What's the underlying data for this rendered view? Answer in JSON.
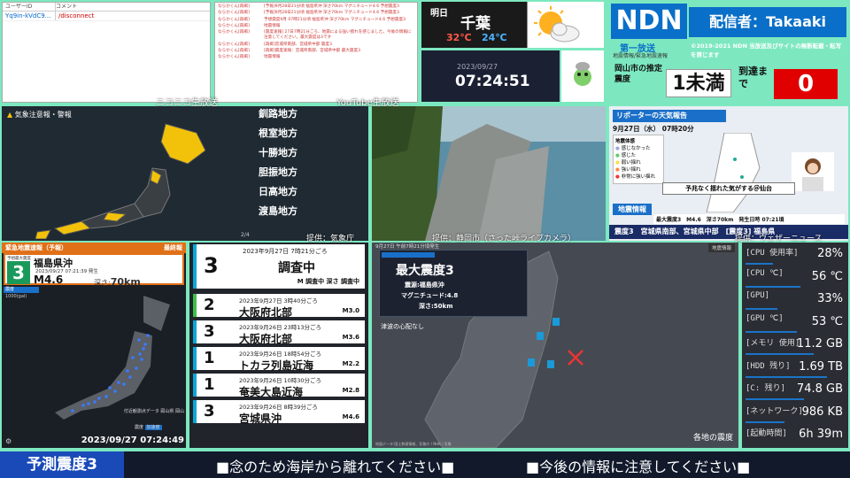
{
  "chat": {
    "header_user": "ユーザーID",
    "header_comment": "コメント",
    "rows": [
      {
        "user": "Yq9in-kVdC9...",
        "text": "/disconnect"
      }
    ]
  },
  "comments": [
    {
      "user": "ならかくん[再掲]",
      "text": "[予報]9月28日21分頃 福島県沖 深さ70km マグニチュード4.6 予想震度3"
    },
    {
      "user": "ならかくん[再掲]",
      "text": "[予報]9月28日21分頃 福島県沖 深さ70km マグニチュード4.6 予想震度3"
    },
    {
      "user": "ならかくん[再掲]",
      "text": "予想震度9月 07時21分頃 福島県沖 深さ70km マグニチュード4.6 予想震度3"
    },
    {
      "user": "ならかくん[再掲]",
      "text": "地震情報"
    },
    {
      "user": "ならかくん[再掲]",
      "text": "[震度速報] 27日7時21分ごろ、地震による強い揺れを感じました。今後の情報に注意してください。最大震度は3です"
    },
    {
      "user": "ならかくん[再掲]",
      "text": "[再掲]宮城県南部、宮城県中部 震度3"
    },
    {
      "user": "ならかくん[再掲]",
      "text": "[再掲]震度速報：宮城県南部、宮城県中部 最大震度3"
    },
    {
      "user": "ならかくん[再掲]",
      "text": "地震情報"
    }
  ],
  "weather": {
    "period": "明日",
    "city": "千葉",
    "high": "32℃",
    "low": "24℃",
    "icon": "sun-cloud-icon"
  },
  "clock": {
    "date": "2023/09/27",
    "time": "07:24:51"
  },
  "ndn": {
    "logo": "NDN",
    "broadcaster": "配信者：Takaaki",
    "tagline": "第一放送",
    "sub": "地震情報/緊急地震速報",
    "copyright": "©2019-2021 NDN 当放送及びサイトの無断転載・転写を禁じます",
    "est_label": "岡山市の推定震度",
    "est_value": "1未満",
    "arrival_label": "到達まで",
    "arrival_value": "0"
  },
  "labels": {
    "nico": "ニコニコ生放送",
    "youtube": "YouTube生放送",
    "src_jma": "提供：気象庁",
    "src_cam": "提供：静岡市（さった峠ライブカメラ）",
    "src_wn": "提供：ウェザーニュース"
  },
  "warnmap": {
    "title": "気象注意報・警報",
    "regions": [
      "釧路地方",
      "根室地方",
      "十勝地方",
      "胆振地方",
      "日高地方",
      "渡島地方"
    ],
    "page": "2/4"
  },
  "tv": {
    "title": "リポーターの天気報告",
    "date": "9月27日（水） 07時20分",
    "legend_title": "地震体感",
    "legend": [
      "感じなかった",
      "感じた",
      "弱い揺れ",
      "強い揺れ",
      "非常に強い揺れ"
    ],
    "caption": "予兆なく揺れた気がする＠仙台",
    "info": "地震情報",
    "shindo_line": "最大震度3　M4.6　深さ70km　発生日時 07:21頃",
    "banner": "震度3　宮城県南部、宮城県中部　[震度3] 福島県"
  },
  "eew": {
    "header": "緊急地震速報（予報）",
    "final": "最終報",
    "label": "予想最大震度",
    "intensity": "3",
    "place": "福島県沖",
    "time": "2023/09/27 07:21:39 発生",
    "mag": "M4.6",
    "depth_label": "深さ:",
    "depth": "70km",
    "intensity_label": "震度",
    "scale": "1000(gal)",
    "station": "付近観測点データ 岡山県 岡山",
    "legend": [
      "震度",
      "加速度"
    ],
    "timestamp": "2023/09/27 07:24:49"
  },
  "history": [
    {
      "int": "3",
      "date": "2023年9月27日 7時21分ごろ",
      "place": "調査中",
      "mag": "M 調査中 深さ 調査中",
      "color": "#0aa8d8",
      "big": true
    },
    {
      "int": "2",
      "date": "2023年9月27日 3時40分ごろ",
      "place": "大阪府北部",
      "mag": "M3.0",
      "color": "#3cc04a",
      "big": false
    },
    {
      "int": "3",
      "date": "2023年9月26日 23時13分ごろ",
      "place": "大阪府北部",
      "mag": "M3.6",
      "color": "#0aa8d8",
      "big": false
    },
    {
      "int": "1",
      "date": "2023年9月26日 18時54分ごろ",
      "place": "トカラ列島近海",
      "mag": "M2.2",
      "color": "#0aa8d8",
      "big": false
    },
    {
      "int": "1",
      "date": "2023年9月26日 10時30分ごろ",
      "place": "奄美大島近海",
      "mag": "M2.8",
      "color": "#0aa8d8",
      "big": false
    },
    {
      "int": "3",
      "date": "2023年9月26日 8時39分ごろ",
      "place": "宮城県沖",
      "mag": "M4.6",
      "color": "#0aa8d8",
      "big": false
    }
  ],
  "shindo": {
    "topline": "9月27日 午前7時21分頃発生",
    "title": "最大震度3",
    "epicenter": "震源:福島県沖",
    "magnitude": "マグニチュード:4.8",
    "depth": "深さ:50km",
    "tsunami": "津波の心配なし",
    "caption": "各地の震度",
    "tag": "地震情報",
    "footer": "地図データ:国土数値情報、気象庁 / NHK / 気象"
  },
  "sys": [
    {
      "label": "[CPU 使用率]",
      "value": "28%",
      "pct": 28
    },
    {
      "label": "[CPU ℃]",
      "value": "56 ℃",
      "pct": 56
    },
    {
      "label": "[GPU]",
      "value": "33%",
      "pct": 33
    },
    {
      "label": "[GPU ℃]",
      "value": "53 ℃",
      "pct": 53
    },
    {
      "label": "[メモリ 使用]",
      "value": "11.2 GB",
      "pct": 70
    },
    {
      "label": "[HDD 残り]",
      "value": "1.69 TB",
      "pct": 84
    },
    {
      "label": "[C: 残り]",
      "value": "74.8 GB",
      "pct": 60
    },
    {
      "label": "[ネットワーク]",
      "value": "986 KB",
      "pct": 40
    },
    {
      "label": "[起動時間]",
      "value": "6h 39m",
      "pct": 0
    }
  ],
  "bottom": {
    "label": "予測震度3",
    "msg1": "■念のため海岸から離れてください■",
    "msg2": "■今後の情報に注意してください■"
  }
}
